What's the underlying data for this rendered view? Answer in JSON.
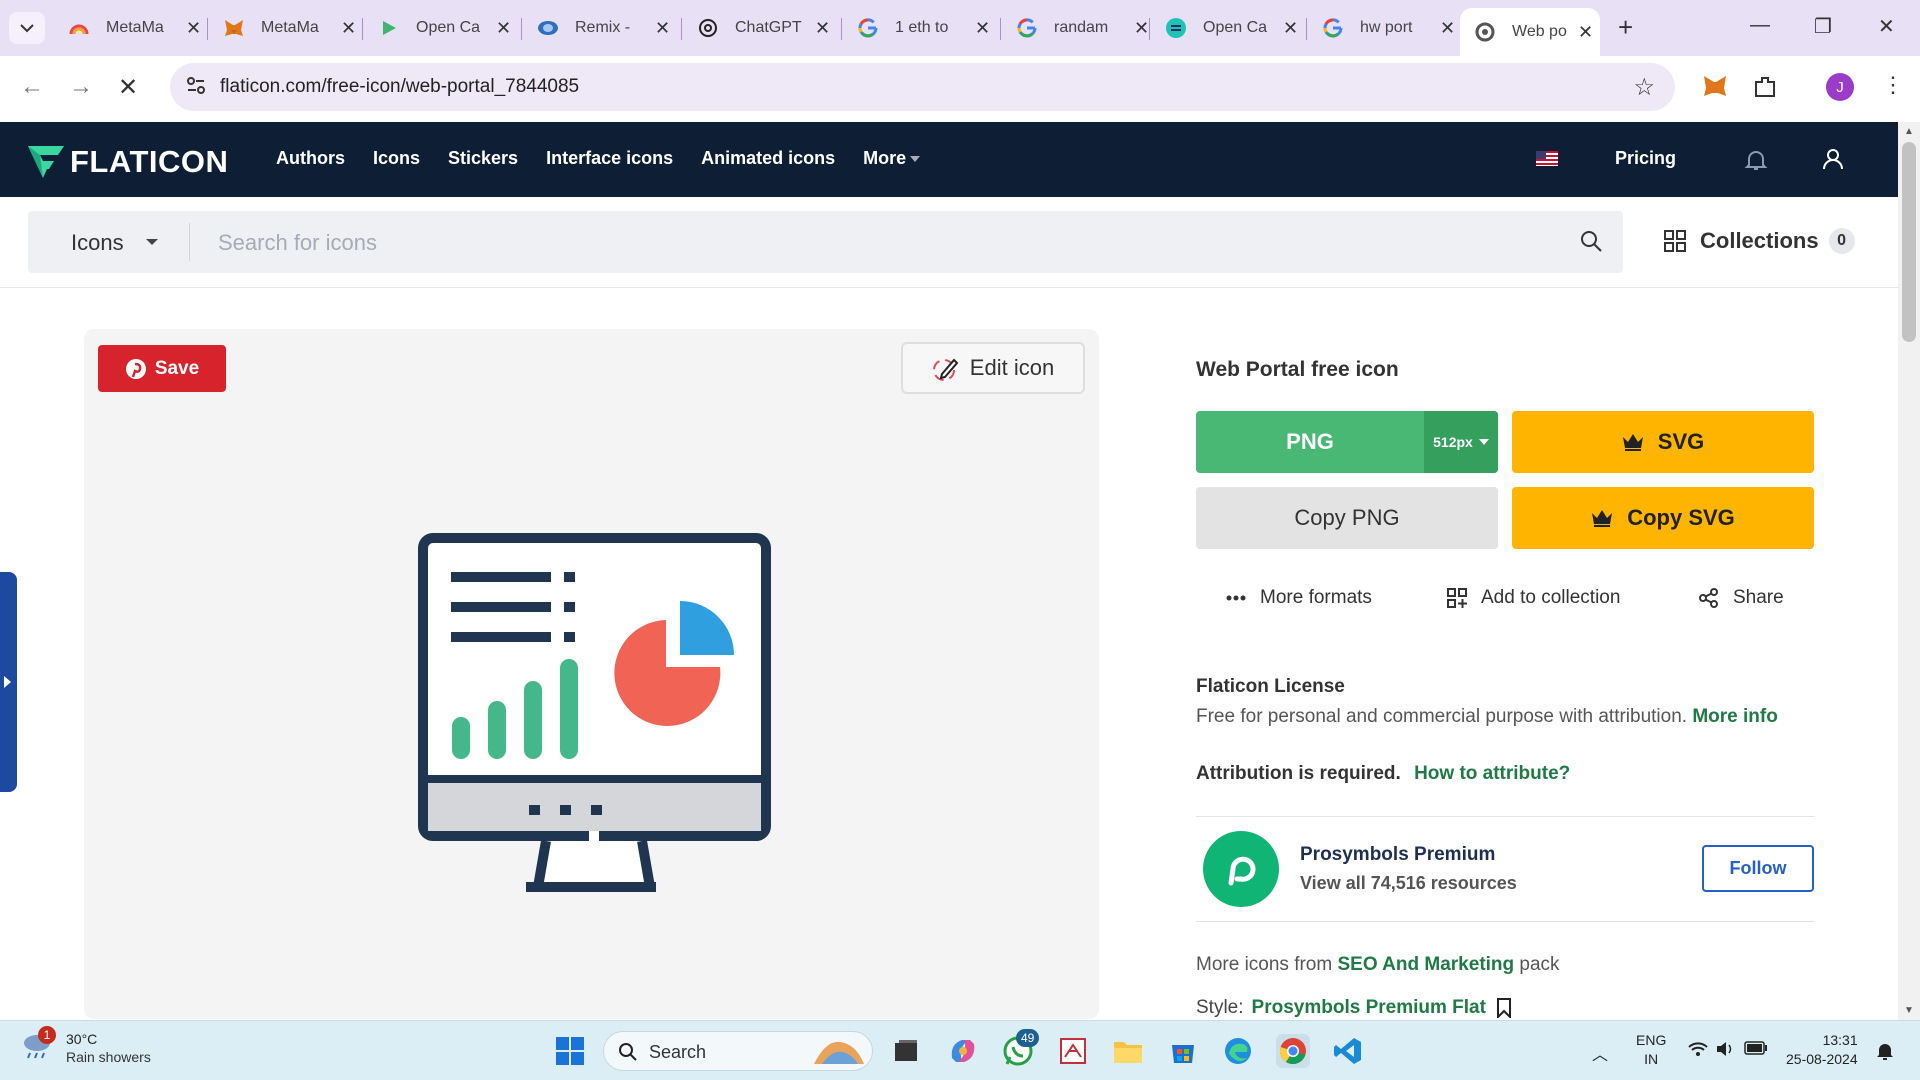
{
  "browser": {
    "tabs": [
      {
        "title": "MetaMa",
        "icon": "rainbow-icon"
      },
      {
        "title": "MetaMa",
        "icon": "metamask-fox-icon"
      },
      {
        "title": "Open Ca",
        "icon": "open-campus-icon"
      },
      {
        "title": "Remix -",
        "icon": "remix-icon"
      },
      {
        "title": "ChatGPT",
        "icon": "chatgpt-icon"
      },
      {
        "title": "1 eth to",
        "icon": "google-icon"
      },
      {
        "title": "randam",
        "icon": "google-icon"
      },
      {
        "title": "Open Ca",
        "icon": "open-campus-icon"
      },
      {
        "title": "hw port",
        "icon": "google-icon"
      },
      {
        "title": "Web po",
        "icon": "flaticon-icon",
        "active": true
      }
    ],
    "url": "flaticon.com/free-icon/web-portal_7844085"
  },
  "header": {
    "logo": "FLATICON",
    "nav": [
      "Authors",
      "Icons",
      "Stickers",
      "Interface icons",
      "Animated icons",
      "More"
    ],
    "pricing": "Pricing"
  },
  "search": {
    "type": "Icons",
    "placeholder": "Search for icons",
    "collections_label": "Collections",
    "collections_count": "0"
  },
  "preview": {
    "save_label": "Save",
    "edit_label": "Edit icon"
  },
  "detail": {
    "title": "Web Portal free icon",
    "png_label": "PNG",
    "png_size": "512px",
    "svg_label": "SVG",
    "copy_png_label": "Copy PNG",
    "copy_svg_label": "Copy SVG",
    "more_formats": "More formats",
    "add_to_collection": "Add to collection",
    "share": "Share",
    "license_title": "Flaticon License",
    "license_text": "Free for personal and commercial purpose with attribution.",
    "license_more": "More info",
    "attribution_text": "Attribution is required.",
    "attribution_link": "How to attribute?",
    "author_name": "Prosymbols Premium",
    "author_resources": "View all 74,516 resources",
    "follow_label": "Follow",
    "more_icons_prefix": "More icons from",
    "more_icons_pack": "SEO And Marketing",
    "more_icons_suffix": "pack",
    "style_label": "Style:",
    "style_value": "Prosymbols Premium Flat"
  },
  "taskbar": {
    "weather_temp": "30°C",
    "weather_desc": "Rain showers",
    "weather_badge": "1",
    "search_label": "Search",
    "whatsapp_count": "49",
    "lang_line1": "ENG",
    "lang_line2": "IN",
    "time": "13:31",
    "date": "25-08-2024"
  },
  "colors": {
    "header_bg": "#0e1e34",
    "png_green": "#4ab875",
    "svg_yellow": "#ffb400",
    "save_red": "#d7242c",
    "link_green": "#1f7a45",
    "follow_blue": "#2560c9"
  }
}
